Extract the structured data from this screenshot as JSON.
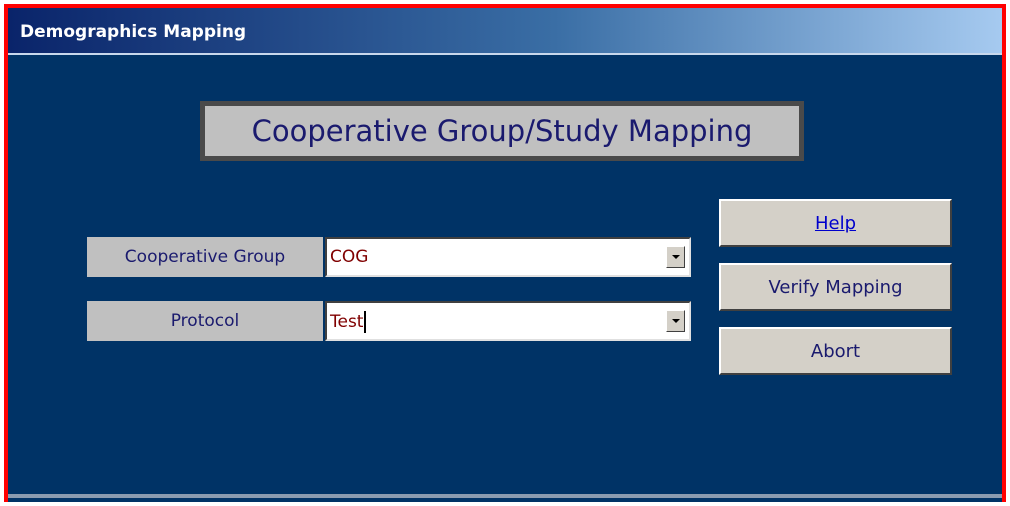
{
  "window": {
    "title": "Demographics Mapping"
  },
  "heading": {
    "text": "Cooperative Group/Study Mapping"
  },
  "fields": {
    "cooperative_group": {
      "label": "Cooperative Group",
      "value": "COG"
    },
    "protocol": {
      "label": "Protocol",
      "value": "Test"
    }
  },
  "buttons": {
    "help": "Help",
    "verify": "Verify Mapping",
    "abort": "Abort"
  },
  "icons": {
    "dropdown": "chevron-down-icon"
  },
  "colors": {
    "background": "#003366",
    "title_gradient_start": "#0a246a",
    "title_gradient_end": "#a6caf0",
    "frame_border": "#ff0000",
    "label_bg": "#c0c0c0",
    "label_text": "#1a1a6e",
    "field_value_text": "#800000",
    "help_link": "#0000cc"
  }
}
